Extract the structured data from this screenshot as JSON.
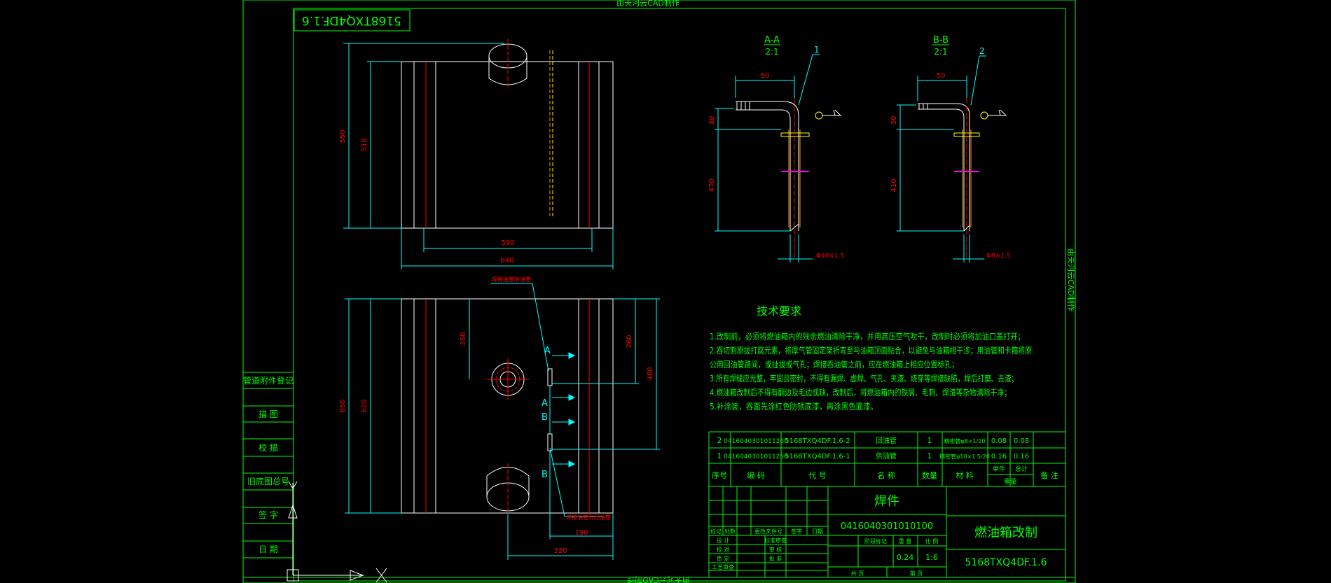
{
  "title_top": "由天河云CAD制作",
  "title_bottom": "由天河云CAD制作",
  "title_right": "由天河云CAD制作",
  "drawing_tag": "5168TXQ4DF.1.6",
  "side_labels": [
    "管道附件登记",
    "描  图",
    "校  描",
    "旧底图总号",
    "签  字",
    "日  期"
  ],
  "section_a": {
    "title": "A-A",
    "scale": "2:1",
    "leader": "1",
    "dim_h": "50",
    "dim_v1": "30",
    "dim_v2": "470",
    "dia": "Φ10×1.5"
  },
  "section_b": {
    "title": "B-B",
    "scale": "2:1",
    "leader": "2",
    "dim_h": "50",
    "dim_v1": "30",
    "dim_v2": "410",
    "dia": "Φ8×1.5"
  },
  "top_view": {
    "dim_w1": "590",
    "dim_w2": "640",
    "dim_h1": "550",
    "dim_h2": "510"
  },
  "front_view": {
    "dim_h1": "650",
    "dim_h2": "620",
    "dim_side1": "260",
    "dim_side2": "260",
    "dim_side3": "460",
    "dim_b1": "190",
    "dim_b2": "320",
    "label_top": "焊接油管附油管",
    "label_bottom": "焊接油管附回油管",
    "marks": [
      "A",
      "A",
      "B",
      "B"
    ]
  },
  "tech": {
    "heading": "技术要求",
    "lines": [
      "1.改制前，必须将燃油箱内的残余燃油清除干净，并用高压空气吹干，改制时必须将加油口盖打开；",
      "2.吞切割原拔打腐元素，将厚气管固定架折弯至与油箱顶面贴合，以避免与油箱相干涉；用油管和卡箍将原",
      "   公用回油管路间，或扯拔或气孔；焊接吞油管之前，应在燃油箱上相应位置标孔；",
      "3.所有焊缝应光整，牢固且密封，不得有漏焊、虚焊、气孔、夹渣、烧穿等焊接缺陷，焊后打磨、去渣；",
      "4.燃油箱改制后不得有翻边及毛边或缺，改制后，将燃油箱内的铁屑、毛刺、焊渣等杂物清除干净；",
      "5.补涂装，吞面先涂红色防锈底漆，再涂黑色面漆。"
    ]
  },
  "bom": {
    "rows": [
      {
        "no": "2",
        "code": "0416040301011260",
        "part": "5168TXQ4DF.1.6-2",
        "name": "回油管",
        "qty": "1",
        "mat": "精密管φ8×1/20",
        "w1": "0.08",
        "w2": "0.08"
      },
      {
        "no": "1",
        "code": "0416040301011250",
        "part": "5168TXQ4DF.1.6-1",
        "name": "供油管",
        "qty": "1",
        "mat": "精密管φ10×1.5/20",
        "w1": "0.16",
        "w2": "0.16"
      }
    ],
    "header": {
      "no": "序号",
      "code": "编  码",
      "part": "代  号",
      "name": "名  称",
      "qty": "数量",
      "mat": "材    料",
      "w_single": "单件",
      "w_total": "总计",
      "weight": "重量",
      "note": "备  注"
    }
  },
  "title_block": {
    "type": "焊件",
    "code": "0416040301010100",
    "product": "燃油箱改制",
    "drawing_no": "5168TXQ4DF.1.6",
    "weight": "0.24",
    "scale": "1:6",
    "labels": {
      "mark": "标记",
      "count": "处数",
      "zone": "更改文件号",
      "sign": "签字",
      "date": "日期",
      "design": "设  计",
      "std": "标准审查",
      "check": "校  对",
      "review": "审  定",
      "audit": "审  核",
      "approve": "批  准",
      "process": "工艺审查",
      "stage": "阶段标记",
      "wt": "重 量",
      "sc": "比 例",
      "sheets": "共    页",
      "sheet": "第    页"
    }
  },
  "colors": {
    "green": "#00ff00",
    "cyan": "#00ffff",
    "red": "#ff0000",
    "white": "#ffffff",
    "yellow": "#ffff00",
    "magenta": "#ff00ff",
    "orange": "#ff9900"
  }
}
